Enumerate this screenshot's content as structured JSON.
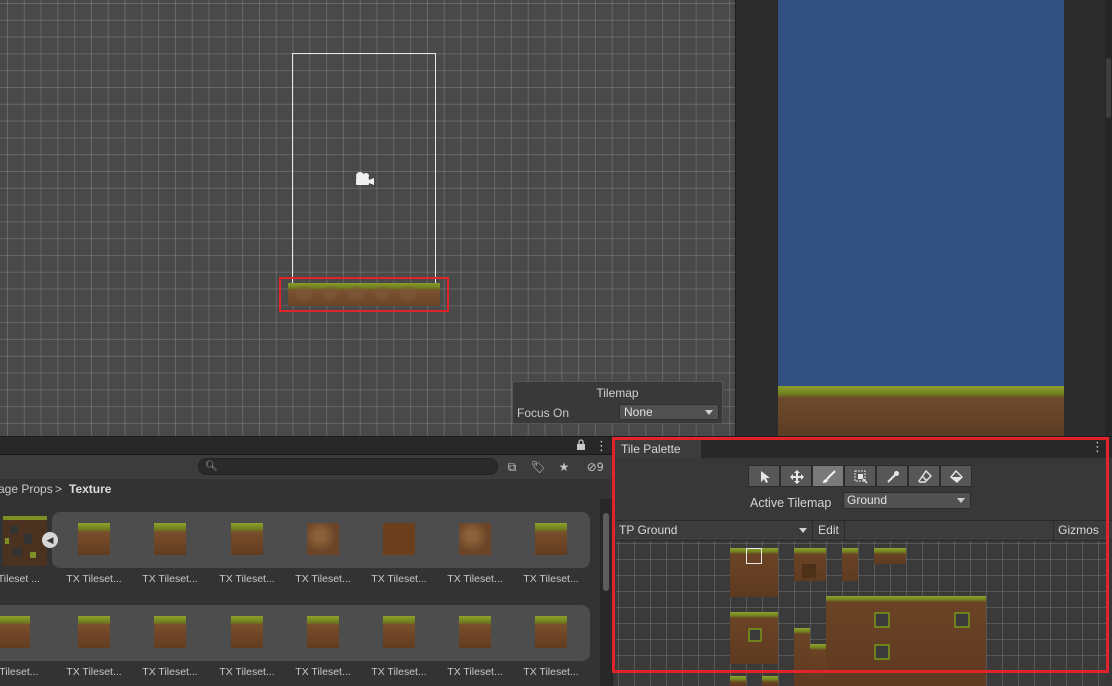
{
  "tilemap_overlay": {
    "title": "Tilemap",
    "focus_label": "Focus On",
    "focus_value": "None"
  },
  "project": {
    "breadcrumb_parent": "age Props",
    "breadcrumb_sep": ">",
    "breadcrumb_current": "Texture",
    "hidden_count": "9",
    "row1_labels": [
      "X Tileset ...",
      "TX Tileset...",
      "TX Tileset...",
      "TX Tileset...",
      "TX Tileset...",
      "TX Tileset...",
      "TX Tileset...",
      "TX Tileset..."
    ],
    "row2_labels": [
      "X Tileset...",
      "TX Tileset...",
      "TX Tileset...",
      "TX Tileset...",
      "TX Tileset...",
      "TX Tileset...",
      "TX Tileset...",
      "TX Tileset..."
    ]
  },
  "palette": {
    "tab_label": "Tile Palette",
    "active_tilemap_label": "Active Tilemap",
    "active_tilemap_value": "Ground",
    "palette_name": "TP Ground",
    "edit_label": "Edit",
    "gizmos_label": "Gizmos",
    "tools": [
      "select-tool",
      "move-tool",
      "paint-tool",
      "box-fill-tool",
      "picker-tool",
      "eraser-tool",
      "fill-tool"
    ],
    "active_tool": "paint-tool"
  },
  "colors": {
    "highlight": "#e0242a",
    "game_sky": "#325082",
    "grass": "#8ea02c",
    "dirt": "#6b4326"
  }
}
